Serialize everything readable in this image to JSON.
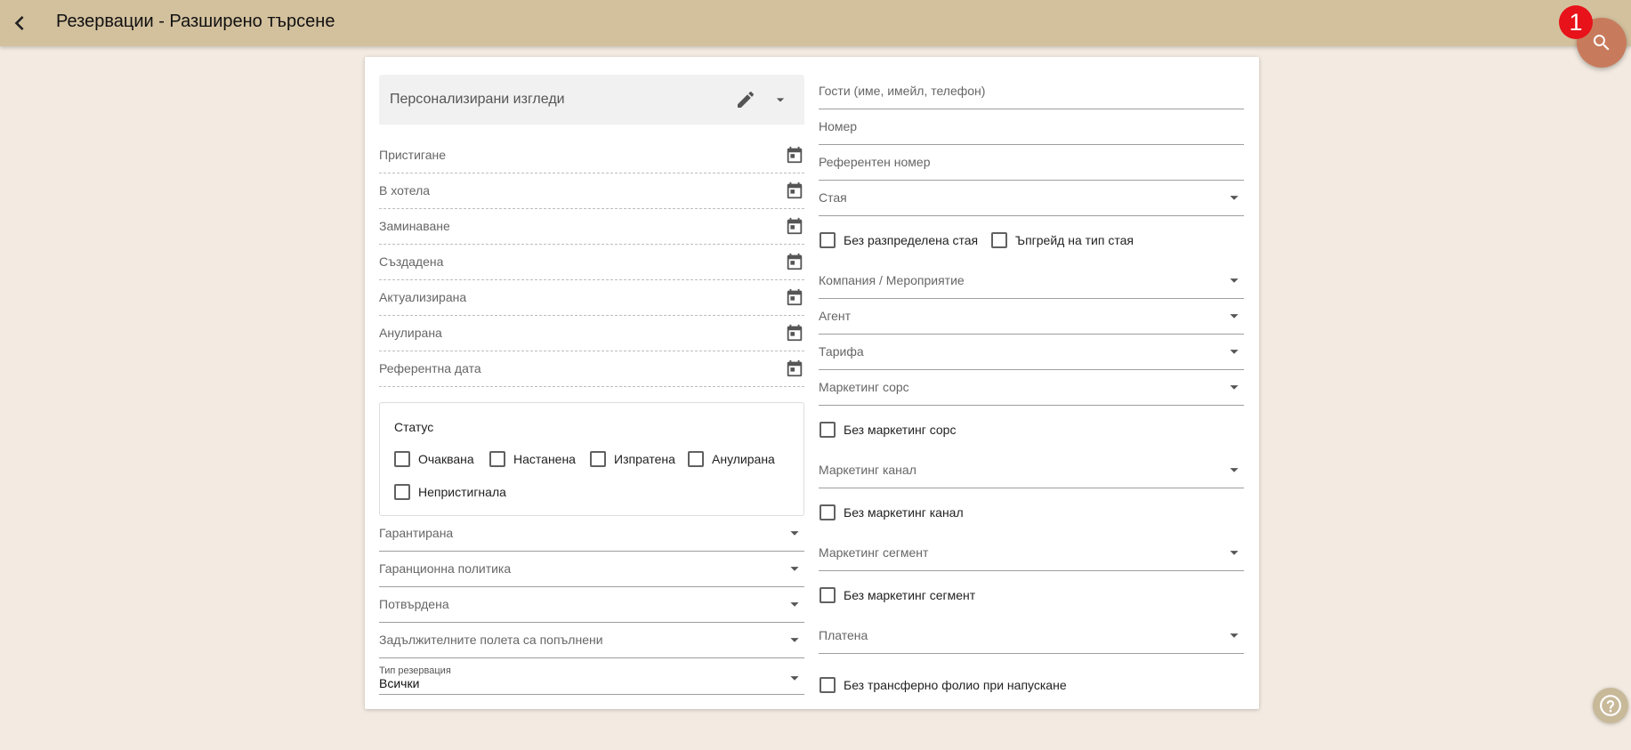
{
  "header": {
    "title": "Резервации - Разширено търсене"
  },
  "fab": {
    "badge": "1"
  },
  "views": {
    "label": "Персонализирани изгледи"
  },
  "left_date_fields": [
    {
      "label": "Пристигане"
    },
    {
      "label": "В хотела"
    },
    {
      "label": "Заминаване"
    },
    {
      "label": "Създадена"
    },
    {
      "label": "Актуализирана"
    },
    {
      "label": "Анулирана"
    },
    {
      "label": "Референтна дата"
    }
  ],
  "status": {
    "title": "Статус",
    "options": [
      "Очаквана",
      "Настанена",
      "Изпратена",
      "Анулирана",
      "Непристигнала"
    ]
  },
  "left_select_fields": [
    {
      "label": "Гарантирана"
    },
    {
      "label": "Гаранционна политика"
    },
    {
      "label": "Потвърдена"
    },
    {
      "label": "Задължителните полета са попълнени"
    }
  ],
  "reservation_type": {
    "label": "Тип резервация",
    "value": "Всички"
  },
  "right_fields": {
    "guests": "Гости (име, имейл, телефон)",
    "number": "Номер",
    "reference_number": "Референтен номер",
    "room": "Стая",
    "no_room_assigned": "Без разпределена стая",
    "room_type_upgrade": "Ъпгрейд на тип стая",
    "company_event": "Компания / Мероприятие",
    "agent": "Агент",
    "rate": "Тарифа",
    "marketing_source": "Маркетинг сорс",
    "no_marketing_source": "Без маркетинг сорс",
    "marketing_channel": "Маркетинг канал",
    "no_marketing_channel": "Без маркетинг канал",
    "marketing_segment": "Маркетинг сегмент",
    "no_marketing_segment": "Без маркетинг сегмент",
    "paid": "Платена",
    "no_transfer_folio": "Без трансферно фолио при напускане"
  },
  "colors": {
    "topbar": "#d3c19e",
    "background": "#f3ebe1",
    "fab": "#c87b5c",
    "badge": "#e8121a"
  },
  "icons": {
    "back": "chevron-left-icon",
    "search": "search-icon",
    "edit": "pencil-icon",
    "calendar": "calendar-icon",
    "dropdown": "arrow-drop-down-icon",
    "help": "question-mark-icon"
  }
}
